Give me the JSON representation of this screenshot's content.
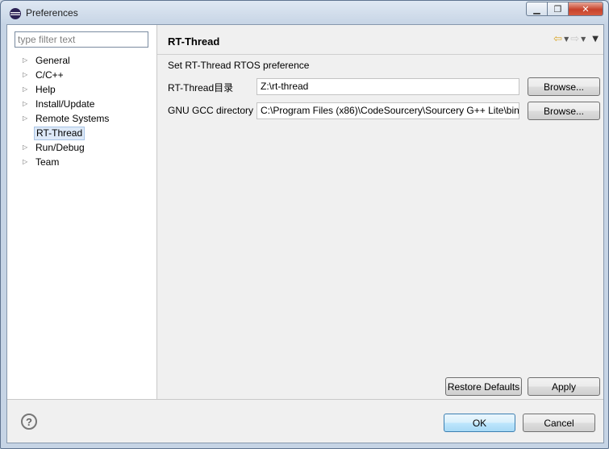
{
  "window": {
    "title": "Preferences"
  },
  "filter": {
    "placeholder": "type filter text"
  },
  "tree": {
    "items": [
      {
        "label": "General",
        "expandable": true
      },
      {
        "label": "C/C++",
        "expandable": true
      },
      {
        "label": "Help",
        "expandable": true
      },
      {
        "label": "Install/Update",
        "expandable": true
      },
      {
        "label": "Remote Systems",
        "expandable": true
      },
      {
        "label": "RT-Thread",
        "expandable": false,
        "selected": true
      },
      {
        "label": "Run/Debug",
        "expandable": true
      },
      {
        "label": "Team",
        "expandable": true
      }
    ]
  },
  "page": {
    "title": "RT-Thread",
    "description": "Set RT-Thread RTOS preference",
    "fields": [
      {
        "label": "RT-Thread目录",
        "value": "Z:\\rt-thread",
        "browse_label": "Browse..."
      },
      {
        "label": "GNU GCC directory",
        "value": "C:\\Program Files (x86)\\CodeSourcery\\Sourcery G++ Lite\\bin",
        "browse_label": "Browse..."
      }
    ],
    "restore_defaults_label": "Restore Defaults",
    "apply_label": "Apply"
  },
  "dialog": {
    "ok_label": "OK",
    "cancel_label": "Cancel",
    "help_glyph": "?"
  },
  "icons": {
    "arrow_right": "▷",
    "back": "⇦",
    "forward": "⇨",
    "dropdown": "▼"
  },
  "colors": {
    "selection": "#dde9f8",
    "primary_button": "#a7d9f5",
    "close_button": "#c7432c"
  }
}
